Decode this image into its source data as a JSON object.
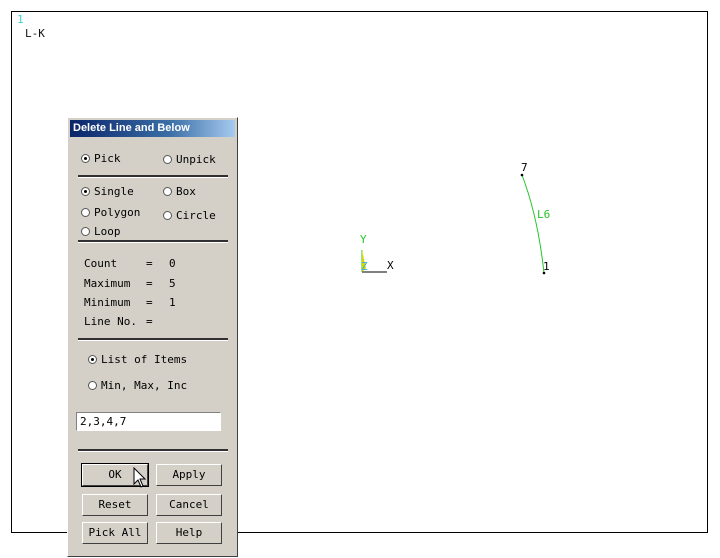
{
  "graphics": {
    "window_number": "1",
    "plot_label": "L-K",
    "axis": {
      "y": "Y",
      "z": "Z",
      "x": "X"
    },
    "keypoints": [
      "7",
      "1"
    ],
    "line_label": "L6",
    "colors": {
      "line": "#25c425",
      "window_number": "#3ad4d4"
    }
  },
  "dialog": {
    "title": "Delete Line and Below",
    "mode": {
      "pick": "Pick",
      "unpick": "Unpick",
      "selected": "pick"
    },
    "shape": {
      "single": "Single",
      "box": "Box",
      "polygon": "Polygon",
      "circle": "Circle",
      "loop": "Loop",
      "selected": "single"
    },
    "info": {
      "count_label": "Count",
      "count_value": "0",
      "maximum_label": "Maximum",
      "maximum_value": "5",
      "minimum_label": "Minimum",
      "minimum_value": "1",
      "lineno_label": "Line No.",
      "eq": "="
    },
    "input_mode": {
      "list": "List of Items",
      "minmax": "Min, Max, Inc",
      "selected": "list"
    },
    "input_value": "2,3,4,7",
    "buttons": {
      "ok": "OK",
      "apply": "Apply",
      "reset": "Reset",
      "cancel": "Cancel",
      "pick_all": "Pick All",
      "help": "Help"
    }
  }
}
